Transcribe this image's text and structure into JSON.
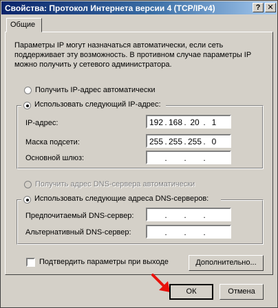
{
  "window": {
    "title": "Свойства: Протокол Интернета версии 4 (TCP/IPv4)",
    "help_button": "?",
    "close_button": "✕"
  },
  "tabs": [
    {
      "label": "Общие",
      "active": true
    }
  ],
  "intro_text": "Параметры IP могут назначаться автоматически, если сеть поддерживает эту возможность. В противном случае параметры IP можно получить у сетевого администратора.",
  "ip_section": {
    "auto_option": "Получить IP-адрес автоматически",
    "manual_option": "Использовать следующий IP-адрес:",
    "selected": "manual",
    "fields": [
      {
        "label": "IP-адрес:",
        "octets": [
          "192",
          "168",
          "20",
          "1"
        ]
      },
      {
        "label": "Маска подсети:",
        "octets": [
          "255",
          "255",
          "255",
          "0"
        ]
      },
      {
        "label": "Основной шлюз:",
        "octets": [
          "",
          "",
          "",
          ""
        ]
      }
    ]
  },
  "dns_section": {
    "auto_option": "Получить адрес DNS-сервера автоматически",
    "auto_disabled": true,
    "manual_option": "Использовать следующие адреса DNS-серверов:",
    "selected": "manual",
    "fields": [
      {
        "label": "Предпочитаемый DNS-сервер:",
        "octets": [
          "",
          "",
          "",
          ""
        ]
      },
      {
        "label": "Альтернативный DNS-сервер:",
        "octets": [
          "",
          "",
          "",
          ""
        ]
      }
    ]
  },
  "validate_checkbox": {
    "label": "Подтвердить параметры при выходе",
    "checked": false
  },
  "buttons": {
    "advanced": "Дополнительно...",
    "ok": "ОК",
    "cancel": "Отмена"
  },
  "colors": {
    "dialog_bg": "#d4d0c8",
    "title_start": "#0a246a",
    "title_end": "#a6caf0",
    "arrow": "#e8120c"
  }
}
